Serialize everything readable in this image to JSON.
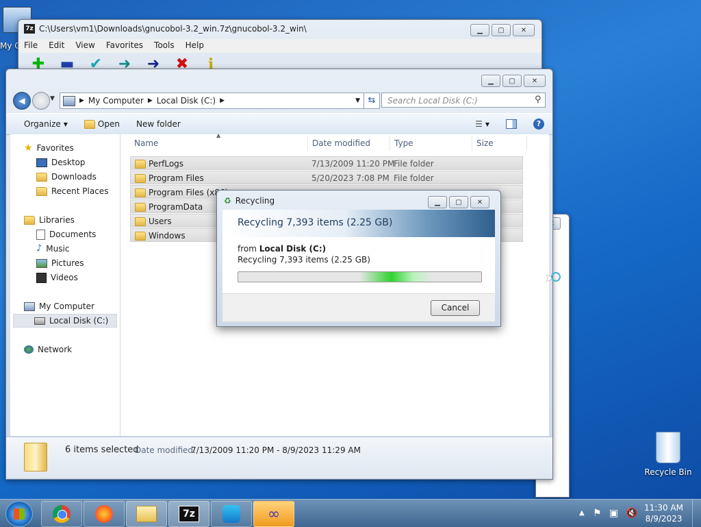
{
  "desktop": {
    "icons": [
      {
        "label": "My C"
      },
      {
        "label": "Recycle Bin"
      }
    ]
  },
  "sevenzip": {
    "title": "C:\\Users\\vm1\\Downloads\\gnucobol-3.2_win.7z\\gnucobol-3.2_win\\",
    "menu": [
      "File",
      "Edit",
      "View",
      "Favorites",
      "Tools",
      "Help"
    ],
    "toolbar": [
      {
        "icon": "add-icon",
        "glyph": "✚",
        "color": "#00b400"
      },
      {
        "icon": "extract-icon",
        "glyph": "▬",
        "color": "#1f3fa8"
      },
      {
        "icon": "test-icon",
        "glyph": "✔",
        "color": "#17a6b5"
      },
      {
        "icon": "copy-icon",
        "glyph": "➜",
        "color": "#138a8a"
      },
      {
        "icon": "move-icon",
        "glyph": "➜",
        "color": "#16238a"
      },
      {
        "icon": "delete-icon",
        "glyph": "✖",
        "color": "#d01010"
      },
      {
        "icon": "info-icon",
        "glyph": "i",
        "color": "#c8a800"
      }
    ]
  },
  "explorer": {
    "breadcrumb": [
      "My Computer",
      "Local Disk (C:)"
    ],
    "search_placeholder": "Search Local Disk (C:)",
    "commands": {
      "organize": "Organize",
      "open": "Open",
      "new_folder": "New folder"
    },
    "nav": {
      "favorites": "Favorites",
      "fav_items": [
        "Desktop",
        "Downloads",
        "Recent Places"
      ],
      "libraries": "Libraries",
      "lib_items": [
        "Documents",
        "Music",
        "Pictures",
        "Videos"
      ],
      "computer": "My Computer",
      "computer_items": [
        "Local Disk (C:)"
      ],
      "network": "Network"
    },
    "columns": {
      "name": "Name",
      "date": "Date modified",
      "type": "Type",
      "size": "Size"
    },
    "rows": [
      {
        "name": "PerfLogs",
        "date": "7/13/2009 11:20 PM",
        "type": "File folder"
      },
      {
        "name": "Program Files",
        "date": "5/20/2023 7:08 PM",
        "type": "File folder"
      },
      {
        "name": "Program Files (x86)",
        "date": "",
        "type": ""
      },
      {
        "name": "ProgramData",
        "date": "",
        "type": ""
      },
      {
        "name": "Users",
        "date": "",
        "type": ""
      },
      {
        "name": "Windows",
        "date": "",
        "type": ""
      }
    ],
    "details": {
      "selected": "6 items selected",
      "date_label": "Date modified:",
      "date_range": "7/13/2009 11:20 PM - 8/9/2023 11:29 AM"
    }
  },
  "dialog": {
    "title": "Recycling",
    "heading": "Recycling 7,393 items (2.25 GB)",
    "from_label": "from",
    "from_value": "Local Disk (C:)",
    "status": "Recycling 7,393 items (2.25 GB)",
    "cancel": "Cancel"
  },
  "taskbar": {
    "apps": [
      "start-button",
      "chrome-icon",
      "firefox-icon",
      "file-manager-icon",
      "7zip-icon",
      "app-icon",
      "windbg-icon"
    ],
    "sevenzip_label": "7z",
    "time": "11:30 AM",
    "date": "8/9/2023"
  }
}
